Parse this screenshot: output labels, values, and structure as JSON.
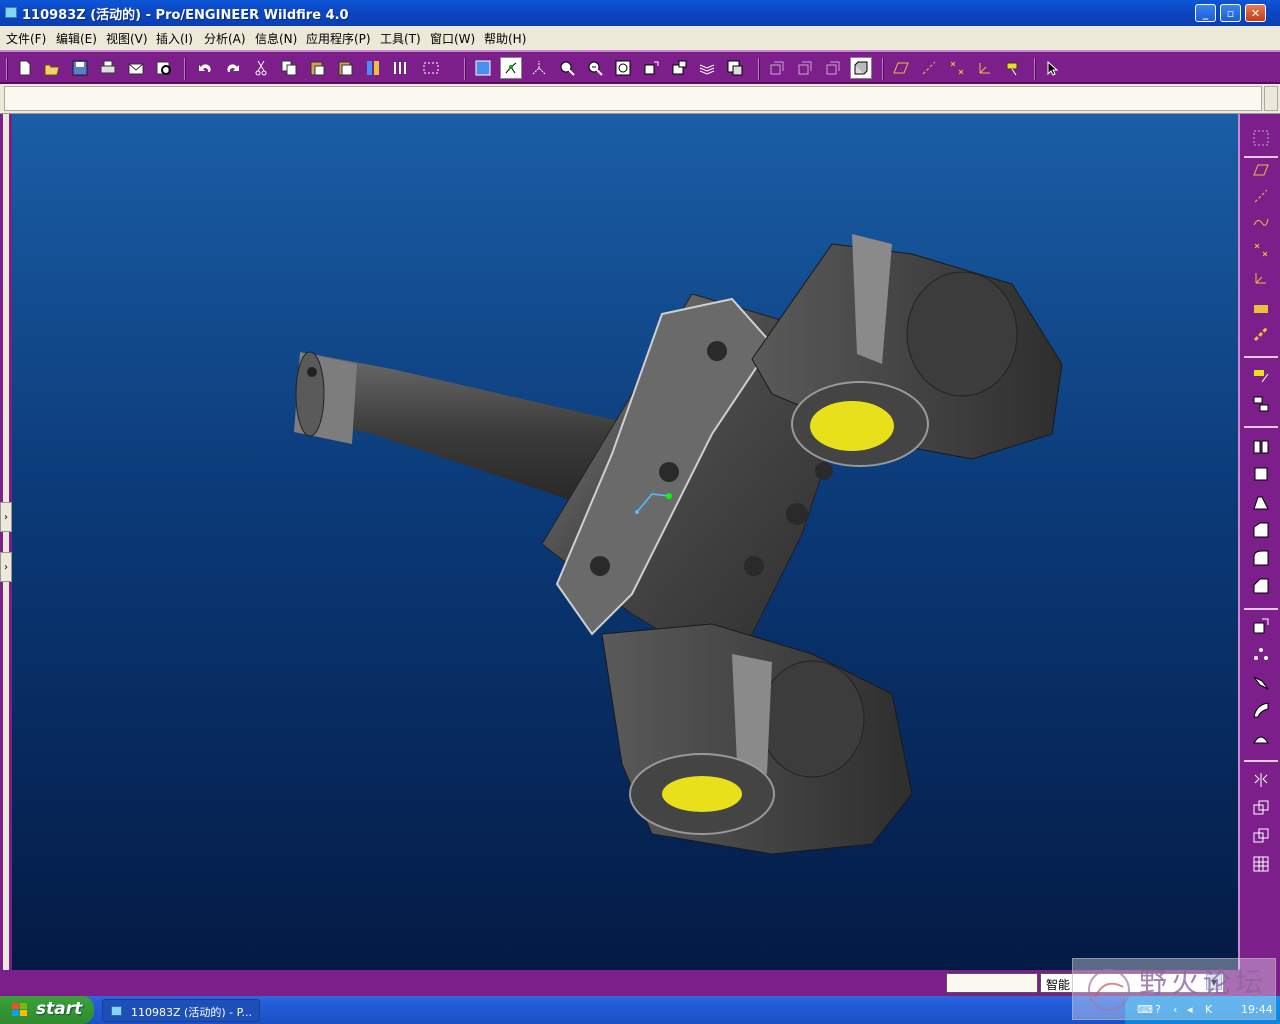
{
  "window": {
    "title": "110983Z (活动的) - Pro/ENGINEER Wildfire 4.0"
  },
  "menubar": {
    "items": [
      "文件(F)",
      "编辑(E)",
      "视图(V)",
      "插入(I)",
      "分析(A)",
      "信息(N)",
      "应用程序(P)",
      "工具(T)",
      "窗口(W)",
      "帮助(H)"
    ]
  },
  "toolbar": {
    "icons": [
      "new-icon",
      "open-icon",
      "save-icon",
      "print-icon",
      "send-icon",
      "preview-icon",
      "undo-icon",
      "redo-icon",
      "cut-icon",
      "copy-icon",
      "paste-icon",
      "paste-special-icon",
      "regenerate-icon",
      "manager-icon",
      "select-box-icon",
      "repaint-icon",
      "spin-center-icon",
      "orient-icon",
      "zoom-in-icon",
      "zoom-out-icon",
      "refit-icon",
      "reorient-icon",
      "saved-views-icon",
      "layers-icon",
      "view-manager-icon",
      "wireframe-icon",
      "hidden-line-icon",
      "no-hidden-icon",
      "shading-icon",
      "datum-planes-icon",
      "datum-axes-icon",
      "datum-points-icon",
      "datum-csys-icon",
      "annotation-icon",
      "context-help-icon"
    ]
  },
  "right_toolbar": {
    "icons": [
      "sketched-datum-icon",
      "datum-plane-icon",
      "datum-axis-icon",
      "datum-curve-icon",
      "datum-point-icon",
      "datum-csys-icon",
      "analysis-icon",
      "insert-feature-icon",
      "sketch-icon",
      "mirror-icon",
      "extrude-icon",
      "revolve-icon",
      "variable-sweep-icon",
      "blend-icon",
      "style-icon",
      "boundary-blend-icon",
      "round-icon",
      "chamfer-icon",
      "draft-icon",
      "shell-icon",
      "rib-icon",
      "pattern-icon",
      "merge-icon",
      "trim-icon",
      "thicken-icon",
      "solidify-icon"
    ]
  },
  "statusbar": {
    "filter_value": "智能"
  },
  "taskbar": {
    "start_label": "start",
    "task_label": "110983Z (活动的) - P...",
    "clock": "19:44"
  },
  "watermark": {
    "text": "野火论坛"
  },
  "colors": {
    "toolbar_purple": "#7c1f8a",
    "canvas_top": "#1a5ea6",
    "canvas_bottom": "#031a44",
    "bushing_yellow": "#e8e01a"
  }
}
